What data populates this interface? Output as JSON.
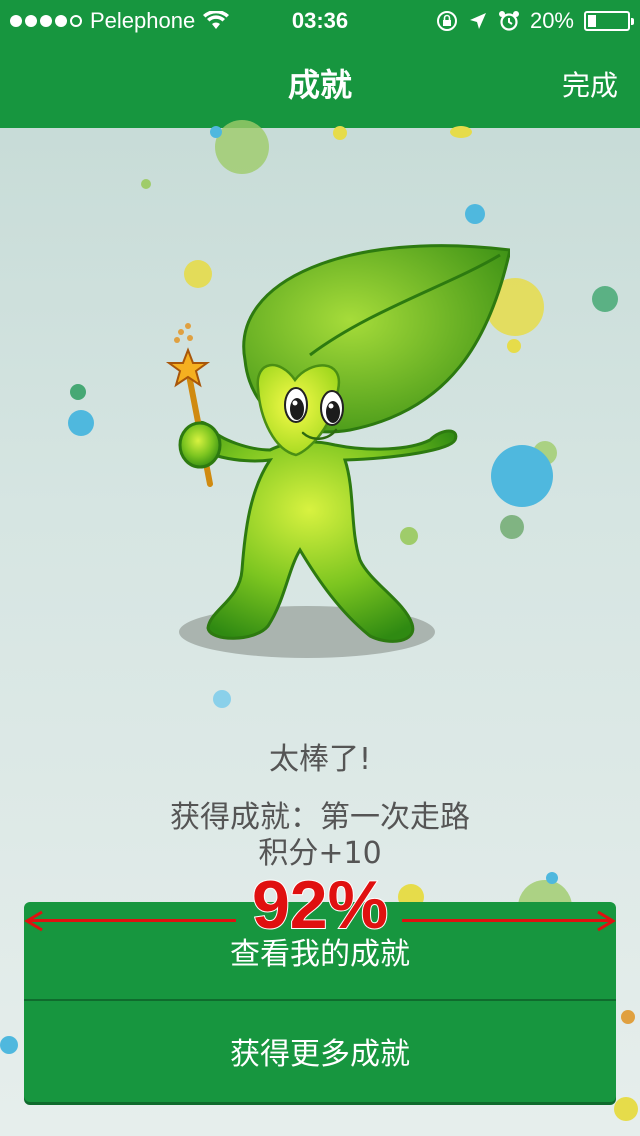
{
  "status_bar": {
    "carrier": "Pelephone",
    "time": "03:36",
    "battery": "20%",
    "battery_level": 0.2,
    "signal_bars_filled": 4,
    "signal_bars_total": 5
  },
  "nav": {
    "title": "成就",
    "done_label": "完成"
  },
  "message": {
    "headline": "太棒了!",
    "achievement": "获得成就：第一次走路",
    "points": "积分+10"
  },
  "buttons": {
    "view_achievements": "查看我的成就",
    "get_more": "获得更多成就"
  },
  "overlay": {
    "percent": "92%"
  },
  "colors": {
    "brand_green": "#17963f",
    "overlay_red": "#e01010"
  }
}
